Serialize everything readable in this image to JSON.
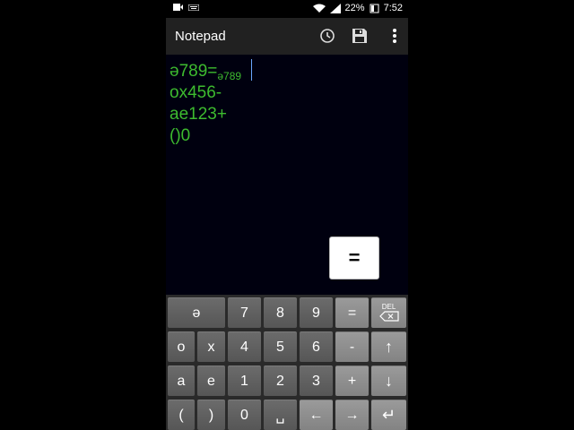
{
  "status_bar": {
    "battery": "22%",
    "time": "7:52"
  },
  "app_bar": {
    "title": "Notepad",
    "icons": [
      "history-icon",
      "save-icon",
      "more-vert-icon"
    ]
  },
  "editor": {
    "lines": [
      {
        "text": "ə789=",
        "result": "ə789"
      },
      {
        "text": "ox456-"
      },
      {
        "text": "ae123+"
      },
      {
        "text": "()0"
      }
    ],
    "float_button": "="
  },
  "keyboard": {
    "rows": [
      [
        "ə",
        "7",
        "8",
        "9",
        "=",
        "DEL"
      ],
      [
        "o",
        "x",
        "4",
        "5",
        "6",
        "-",
        "↑"
      ],
      [
        "a",
        "e",
        "1",
        "2",
        "3",
        "+",
        "↓"
      ],
      [
        "(",
        ")",
        "0",
        "␣",
        "←",
        "→",
        "↵"
      ]
    ]
  },
  "colors": {
    "text_green": "#3dbb2f",
    "editor_bg": "#00000f",
    "app_bar_bg": "#212121",
    "key_bg": "#606060",
    "key_op_bg": "#8e8e8e"
  }
}
